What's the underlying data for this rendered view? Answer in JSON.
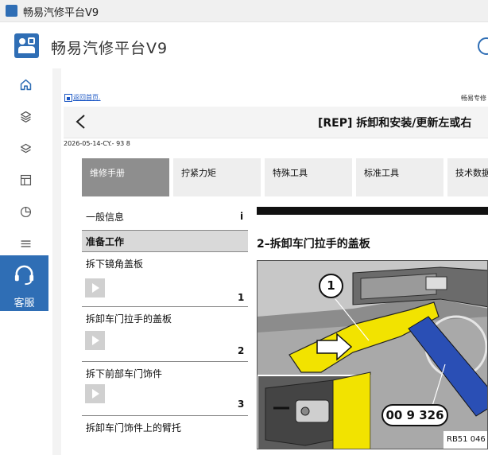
{
  "window": {
    "title": "畅易汽修平台V9"
  },
  "header": {
    "app_title": "畅易汽修平台V9"
  },
  "sidebar": {
    "items": [
      {
        "icon": "home-icon"
      },
      {
        "icon": "layers-icon"
      },
      {
        "icon": "stack-icon"
      },
      {
        "icon": "layout-icon"
      },
      {
        "icon": "pie-chart-icon"
      },
      {
        "icon": "menu-icon"
      }
    ],
    "service": {
      "label": "客服",
      "icon": "headset-icon"
    }
  },
  "doc": {
    "home_link": "返回首页.",
    "brand_right": "畅易专修",
    "title": "[REP] 拆卸和安装/更新左或右",
    "date": "2026-05-14-CY.- 93 8",
    "tabs": [
      "维修手册",
      "拧紧力矩",
      "特殊工具",
      "标准工具",
      "技术数据"
    ],
    "toc": {
      "general": {
        "label": "一般信息",
        "mark": "i"
      },
      "prep": "准备工作",
      "steps": [
        {
          "label": "拆下镜角盖板",
          "num": "1"
        },
        {
          "label": "拆卸车门拉手的盖板",
          "num": "2"
        },
        {
          "label": "拆下前部车门饰件",
          "num": "3"
        },
        {
          "label": "拆卸车门饰件上的臂托",
          "num": ""
        }
      ]
    },
    "section_title": "2–拆卸车门拉手的盖板",
    "figure": {
      "callout_1": "1",
      "tool_number": "00 9 326",
      "code": "RB51 046"
    }
  },
  "colors": {
    "accent": "#2f6eb5",
    "active_tab": "#8e8e8e",
    "highlight_yellow": "#f2e300",
    "tool_blue": "#2a4fb5"
  }
}
